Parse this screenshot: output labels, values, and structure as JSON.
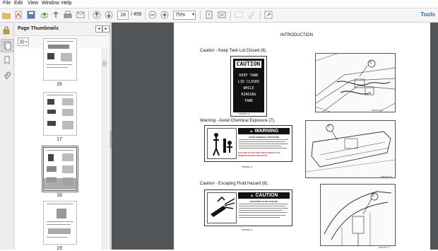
{
  "menu": {
    "file": "File",
    "edit": "Edit",
    "view": "View",
    "window": "Window",
    "help": "Help"
  },
  "toolbar": {
    "current_page": "18",
    "total_pages": "/ 456",
    "zoom": "75%",
    "tools": "Tools"
  },
  "panel": {
    "title": "Page Thumbnails"
  },
  "thumbnails": [
    {
      "label": "16"
    },
    {
      "label": "17"
    },
    {
      "label": "18"
    },
    {
      "label": "19"
    }
  ],
  "document": {
    "heading": "INTRODUCTION",
    "sections": [
      {
        "title": "Caution - Keep Tank Lid Closed (6).",
        "decal_header": "CAUTION",
        "decal_lines": [
          "KEEP TANK",
          "LID CLOSED",
          "WHILE",
          "RINSING",
          "TANK"
        ],
        "decal_caption": "SD0B00        13",
        "photo_caption": "SD0C04        13",
        "callout": "6"
      },
      {
        "title": "Warning - Avoid Chemical Exposure (7).",
        "decal_header": "WARNING",
        "decal_sub": "AVOID CHEMICAL EXPOSURE",
        "decal_red_text": "FAILURE TO DO THIS COULD RESULT IN SERIOUS INJURY OR DEATH.",
        "decal_caption": "SD0B00        14",
        "photo_caption": "SD0C05        15",
        "callout": "7"
      },
      {
        "title": "Caution - Escaping Fluid Hazard (8).",
        "decal_header": "CAUTION",
        "decal_sub": "ESCAPING FLUID HAZARD",
        "decal_caption": "SD0B00        16",
        "photo_caption": "SD0C07        17",
        "callout": "8"
      }
    ]
  }
}
